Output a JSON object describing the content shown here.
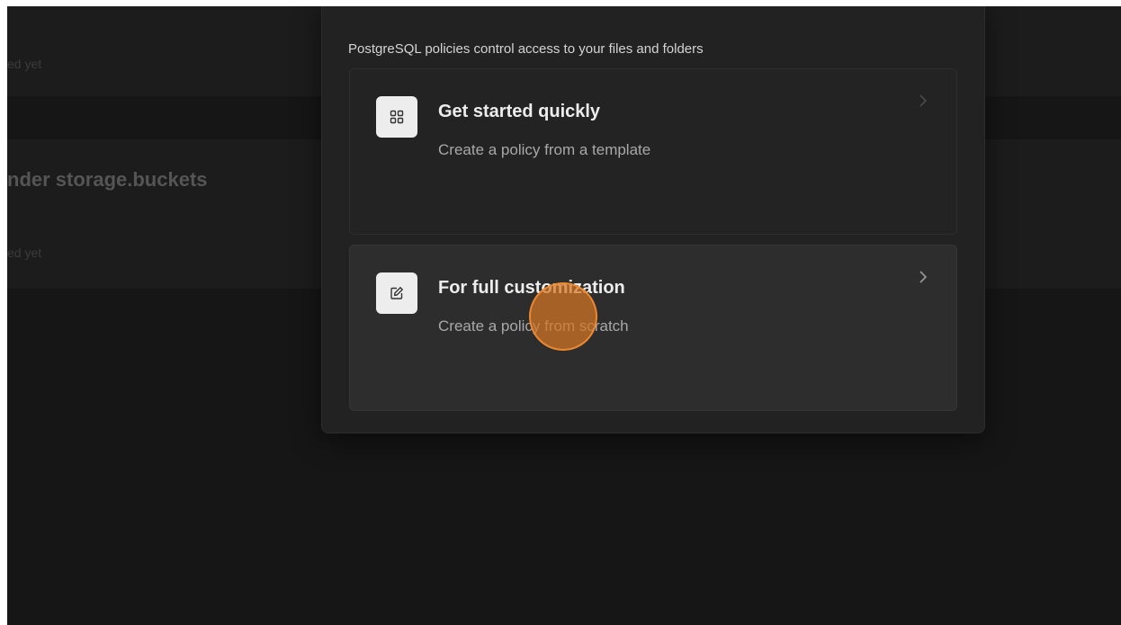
{
  "background": {
    "top_status_text": "ed yet",
    "section_heading": "nder storage.buckets",
    "section_status_text": "ed yet"
  },
  "modal": {
    "description": "PostgreSQL policies control access to your files and folders",
    "options": [
      {
        "title": "Get started quickly",
        "subtitle": "Create a policy from a template",
        "icon": "grid-template-icon"
      },
      {
        "title": "For full customization",
        "subtitle": "Create a policy from scratch",
        "icon": "edit-icon"
      }
    ]
  },
  "colors": {
    "accent": "#d67626",
    "background": "#161616",
    "modal": "#222222"
  }
}
